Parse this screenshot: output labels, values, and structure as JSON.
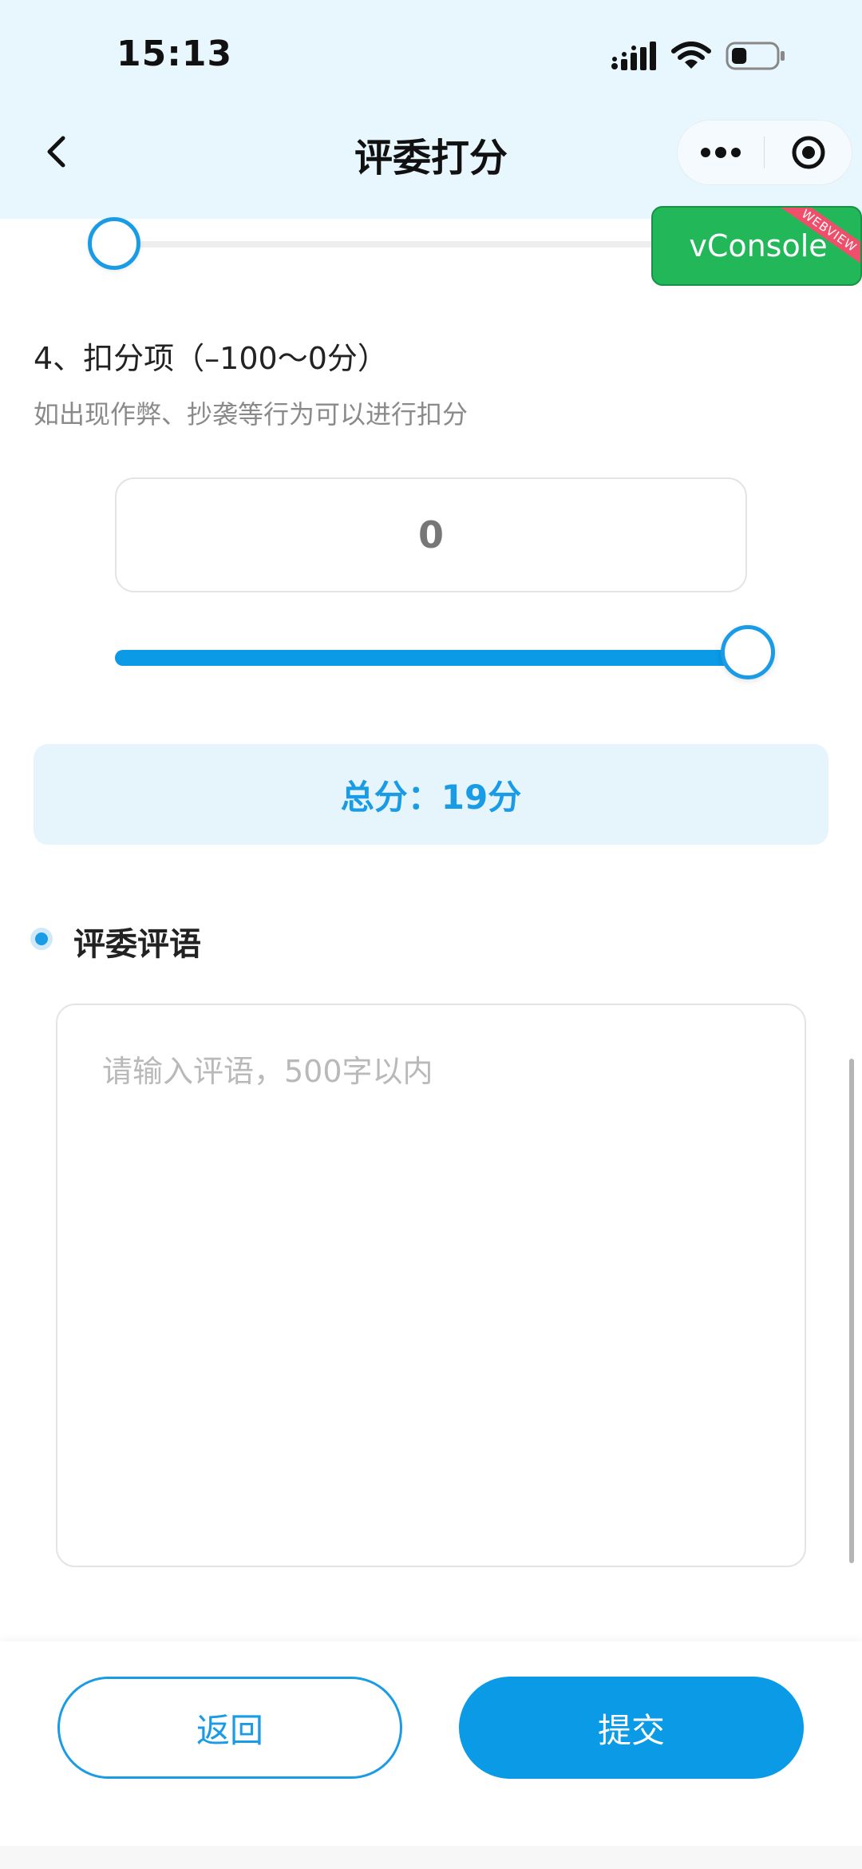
{
  "status_bar": {
    "time": "15:13",
    "icons": [
      "cellular-signal-icon",
      "wifi-icon",
      "battery-icon"
    ],
    "battery_level": 0.35
  },
  "nav": {
    "title": "评委打分",
    "icons": [
      "back-arrow-icon",
      "more-dots-icon",
      "target-circle-icon"
    ]
  },
  "vconsole": {
    "label": "vConsole",
    "ribbon": "WEBVIEW"
  },
  "previous_item": {
    "slider_value_fraction": 0.0
  },
  "section4": {
    "title": "4、扣分项（–100～0分）",
    "description": "如出现作弊、抄袭等行为可以进行扣分",
    "score": "0",
    "slider_min": -100,
    "slider_max": 0,
    "slider_value": 0
  },
  "total": {
    "text": "总分：19分"
  },
  "comment": {
    "heading": "评委评语",
    "placeholder": "请输入评语，500字以内",
    "value": ""
  },
  "actions": {
    "back_label": "返回",
    "submit_label": "提交"
  },
  "colors": {
    "accent": "#0a9ae6",
    "header_bg": "#e8f6fd",
    "total_bg": "#e6f4fc",
    "vconsole_green": "#22b85a",
    "ribbon_red": "#ef4f6b"
  }
}
